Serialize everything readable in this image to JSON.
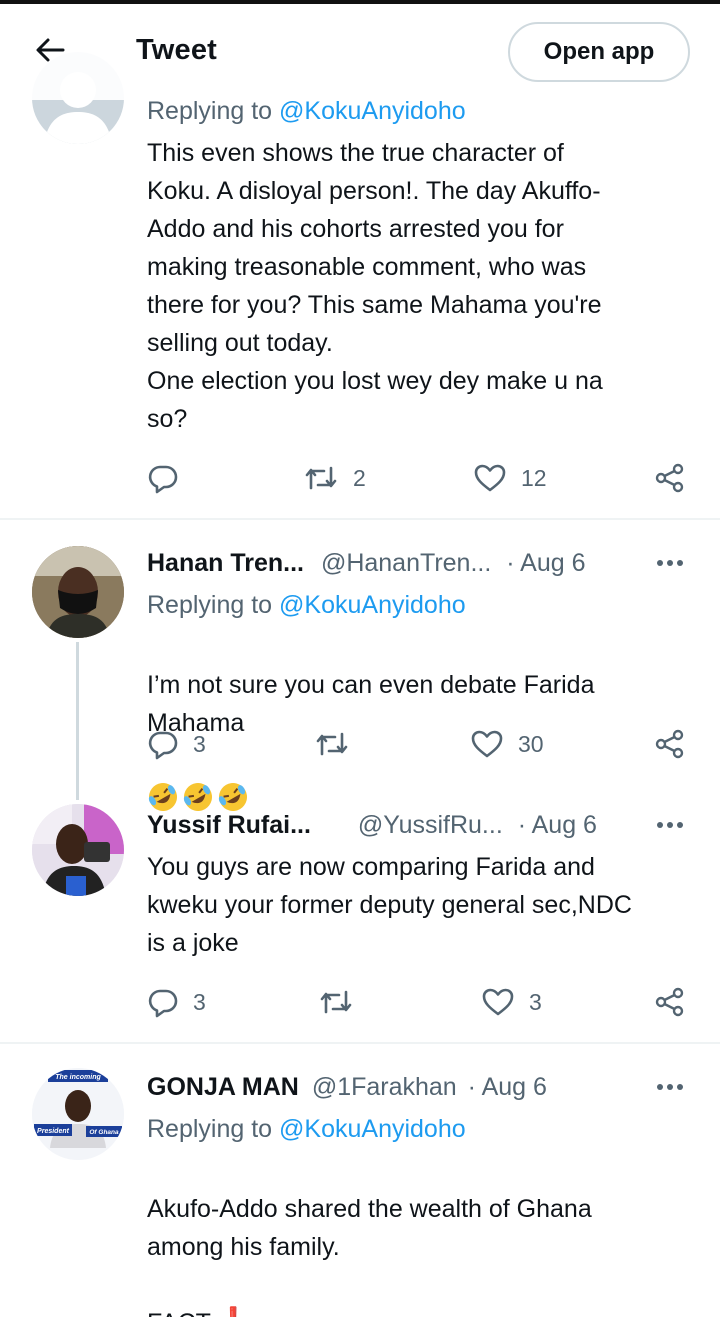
{
  "header": {
    "title": "Tweet",
    "open_app_label": "Open app"
  },
  "tweets": [
    {
      "replying_prefix": "Replying to",
      "replying_handle": "@KokuAnyidoho",
      "text": "This even shows the true character of\nKoku. A disloyal person!. The day Akuffo-\nAddo and his cohorts arrested you for\nmaking treasonable comment, who was\nthere for you? This same Mahama you're\nselling out today.\nOne election you lost wey dey make u na\nso?",
      "replies": "",
      "retweets": "2",
      "likes": "12"
    },
    {
      "name": "Hanan Tren...",
      "handle": "@HananTren...",
      "date": "· Aug 6",
      "replying_prefix": "Replying to",
      "replying_handle": "@KokuAnyidoho",
      "text": "I’m not sure you can even debate Farida\nMahama",
      "emoji": "rolling-on-floor-laughing x3",
      "replies": "3",
      "retweets": "",
      "likes": "30"
    },
    {
      "name": "Yussif Rufai...",
      "handle": "@YussifRu...",
      "date": "· Aug 6",
      "text": "You guys are now comparing Farida and\nkweku your former deputy general sec,NDC\nis a joke",
      "replies": "3",
      "retweets": "",
      "likes": "3"
    },
    {
      "name": "GONJA MAN",
      "handle": "@1Farakhan",
      "date": "· Aug 6",
      "replying_prefix": "Replying to",
      "replying_handle": "@KokuAnyidoho",
      "text": "Akufo-Addo shared the wealth of Ghana\namong his family.\n\nFACT",
      "emoji": "red-exclamation",
      "avatar_banner_top": "The incoming",
      "avatar_banner_left": "President",
      "avatar_banner_right": "Of Ghana"
    }
  ],
  "icons": {
    "back": "arrow-left-icon",
    "reply": "reply-icon",
    "retweet": "retweet-icon",
    "like": "heart-icon",
    "share": "share-icon",
    "more": "more-dots-icon"
  },
  "colors": {
    "link": "#1d9bf0",
    "secondary": "#536471",
    "divider": "#eff3f4"
  }
}
